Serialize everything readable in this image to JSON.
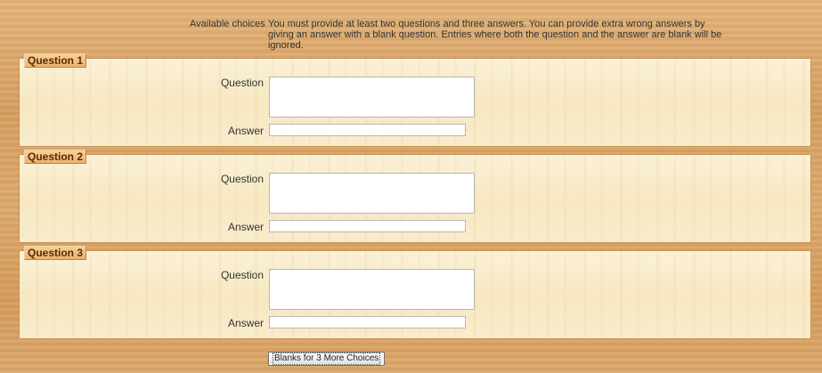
{
  "intro": {
    "label": "Available choices",
    "text": "You must provide at least two questions and three answers. You can provide extra wrong answers by giving an answer with a blank question. Entries where both the question and the answer are blank will be ignored."
  },
  "questions": [
    {
      "legend": "Question 1",
      "question_label": "Question",
      "question_value": "",
      "answer_label": "Answer",
      "answer_value": ""
    },
    {
      "legend": "Question 2",
      "question_label": "Question",
      "question_value": "",
      "answer_label": "Answer",
      "answer_value": ""
    },
    {
      "legend": "Question 3",
      "question_label": "Question",
      "question_value": "",
      "answer_label": "Answer",
      "answer_value": ""
    }
  ],
  "blanks_button": {
    "label": "Blanks for 3 More Choices"
  }
}
